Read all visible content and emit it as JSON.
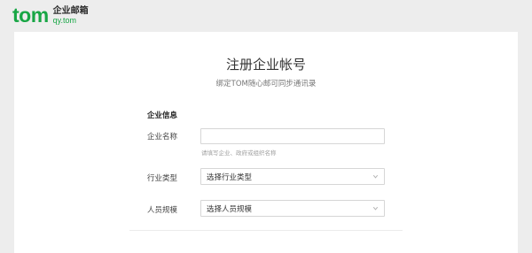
{
  "brand": {
    "logo_text": "tom",
    "name_cn": "企业邮箱",
    "domain": "qy.tom"
  },
  "page": {
    "title": "注册企业帐号",
    "subtitle": "绑定TOM随心邮可同步通讯录"
  },
  "form": {
    "section_heading": "企业信息",
    "company_name": {
      "label": "企业名称",
      "value": "",
      "hint": "请填写企业、政府或组织名称"
    },
    "industry": {
      "label": "行业类型",
      "selected": "选择行业类型",
      "icon": "chevron-down-icon"
    },
    "staff_size": {
      "label": "人员规模",
      "selected": "选择人员规模",
      "icon": "chevron-down-icon"
    }
  },
  "colors": {
    "brand_green": "#18a645",
    "background": "#ededed",
    "card": "#ffffff",
    "border": "#d6d6d6",
    "hint": "#a0a0a0"
  }
}
